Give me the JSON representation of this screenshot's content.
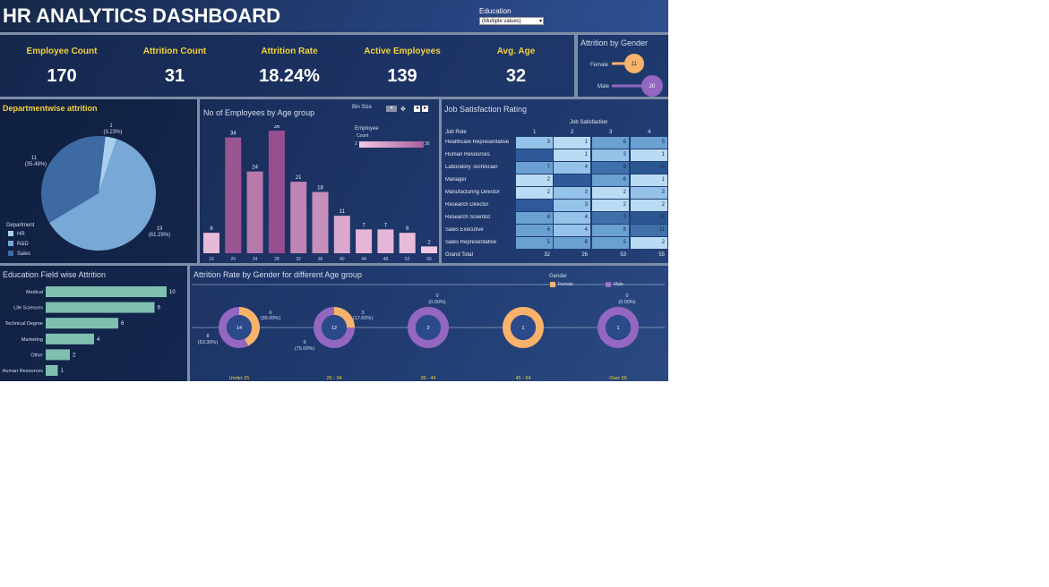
{
  "header": {
    "title": "HR ANALYTICS DASHBOARD",
    "filter_label": "Education",
    "filter_value": "(Multiple values)"
  },
  "kpis": [
    {
      "label": "Employee Count",
      "value": "170"
    },
    {
      "label": "Attrition Count",
      "value": "31"
    },
    {
      "label": "Attrition Rate",
      "value": "18.24%"
    },
    {
      "label": "Active Employees",
      "value": "139"
    },
    {
      "label": "Avg. Age",
      "value": "32"
    }
  ],
  "gender_attrition": {
    "title": "Attrition by Gender",
    "items": [
      {
        "label": "Female",
        "value": 11,
        "color": "#f8b26a"
      },
      {
        "label": "Male",
        "value": 20,
        "color": "#9467c1"
      }
    ]
  },
  "dept_pie": {
    "title": "Departmentwise attrition",
    "legend_title": "Department",
    "slices": [
      {
        "label": "HR",
        "value": 1,
        "pct": "(3.23%)",
        "color": "#a8cfee"
      },
      {
        "label": "R&D",
        "value": 19,
        "pct": "(61.29%)",
        "color": "#78a9d6"
      },
      {
        "label": "Sales",
        "value": 11,
        "pct": "(35.48%)",
        "color": "#3d6aa3"
      }
    ]
  },
  "age_bars": {
    "title": "No of Employees by Age group",
    "bin_label": "Bin Size",
    "bin_value": "4",
    "legend_title": "Employee",
    "legend_sub": "Count",
    "legend_min": "2",
    "legend_max": "36",
    "categories": [
      "16",
      "20",
      "24",
      "28",
      "32",
      "36",
      "40",
      "44",
      "48",
      "52",
      "56"
    ],
    "values": [
      6,
      34,
      24,
      36,
      21,
      18,
      11,
      7,
      7,
      6,
      2
    ]
  },
  "heatmap": {
    "title": "Job Satisfaction Rating",
    "col_title": "Job Satisfaction",
    "row_header": "Job Role",
    "cols": [
      "1",
      "2",
      "3",
      "4"
    ],
    "rows": [
      {
        "role": "Healthcare Representative",
        "values": [
          "3",
          "1",
          "6",
          "5"
        ]
      },
      {
        "role": "Human Resources",
        "values": [
          "",
          "1",
          "3",
          "1"
        ]
      },
      {
        "role": "Laboratory Technician",
        "values": [
          "7",
          "4",
          "9",
          "13"
        ]
      },
      {
        "role": "Manager",
        "values": [
          "2",
          "",
          "6",
          "1"
        ]
      },
      {
        "role": "Manufacturing Director",
        "values": [
          "2",
          "3",
          "2",
          "3"
        ]
      },
      {
        "role": "Research Director",
        "values": [
          "",
          "3",
          "2",
          "2"
        ]
      },
      {
        "role": "Research Scientist",
        "values": [
          "8",
          "4",
          "9",
          "15"
        ]
      },
      {
        "role": "Sales Executive",
        "values": [
          "6",
          "4",
          "8",
          "11"
        ]
      },
      {
        "role": "Sales Representative",
        "values": [
          "5",
          "6",
          "5",
          "2"
        ]
      }
    ],
    "total_label": "Grand Total",
    "totals": [
      "32",
      "26",
      "53",
      "55"
    ]
  },
  "education_bars": {
    "title": "Education Field wise Attrition",
    "items": [
      {
        "label": "Medical",
        "value": 10
      },
      {
        "label": "Life Sciences",
        "value": 9
      },
      {
        "label": "Technical Degree",
        "value": 6
      },
      {
        "label": "Marketing",
        "value": 4
      },
      {
        "label": "Other",
        "value": 2
      },
      {
        "label": "Human Resources",
        "value": 1
      }
    ]
  },
  "donuts": {
    "title": "Attrition Rate by Gender for different Age group",
    "legend_title": "Gender",
    "legend_items": [
      {
        "label": "Female",
        "color": "#f8b26a"
      },
      {
        "label": "Male",
        "color": "#9467c1"
      }
    ],
    "groups": [
      {
        "label": "Under 25",
        "center": "14",
        "female": 6,
        "male": 8,
        "female_txt": "6",
        "female_pct": "(35.00%)",
        "male_txt": "8",
        "male_pct": "(53.30%)"
      },
      {
        "label": "25 - 34",
        "center": "12",
        "female": 3,
        "male": 9,
        "female_txt": "3",
        "female_pct": "(17.65%)",
        "male_txt": "9",
        "male_pct": "(75.00%)"
      },
      {
        "label": "35 - 44",
        "center": "2",
        "female": 0,
        "male": 2,
        "female_txt": "0",
        "female_pct": "(0.00%)",
        "male_txt": "",
        "male_pct": ""
      },
      {
        "label": "45 - 54",
        "center": "1",
        "female": 1,
        "male": 0,
        "female_txt": "",
        "female_pct": "",
        "male_txt": "",
        "male_pct": ""
      },
      {
        "label": "Over 55",
        "center": "1",
        "female": 0,
        "male": 1,
        "female_txt": "0",
        "female_pct": "(0.00%)",
        "male_txt": "",
        "male_pct": ""
      }
    ]
  },
  "chart_data": [
    {
      "type": "pie",
      "title": "Departmentwise attrition",
      "categories": [
        "HR",
        "R&D",
        "Sales"
      ],
      "values": [
        1,
        19,
        11
      ]
    },
    {
      "type": "bar",
      "title": "No of Employees by Age group",
      "categories": [
        "16",
        "20",
        "24",
        "28",
        "32",
        "36",
        "40",
        "44",
        "48",
        "52",
        "56"
      ],
      "values": [
        6,
        34,
        24,
        36,
        21,
        18,
        11,
        7,
        7,
        6,
        2
      ]
    },
    {
      "type": "heatmap",
      "title": "Job Satisfaction Rating",
      "cols": [
        "1",
        "2",
        "3",
        "4"
      ]
    },
    {
      "type": "bar",
      "title": "Education Field wise Attrition",
      "categories": [
        "Medical",
        "Life Sciences",
        "Technical Degree",
        "Marketing",
        "Other",
        "Human Resources"
      ],
      "values": [
        10,
        9,
        6,
        4,
        2,
        1
      ]
    },
    {
      "type": "pie",
      "title": "Attrition Rate by Gender for different Age group",
      "categories": [
        "Under 25",
        "25 - 34",
        "35 - 44",
        "45 - 54",
        "Over 55"
      ],
      "series": [
        {
          "name": "Female",
          "values": [
            6,
            3,
            0,
            1,
            0
          ]
        },
        {
          "name": "Male",
          "values": [
            8,
            9,
            2,
            0,
            1
          ]
        }
      ]
    }
  ]
}
